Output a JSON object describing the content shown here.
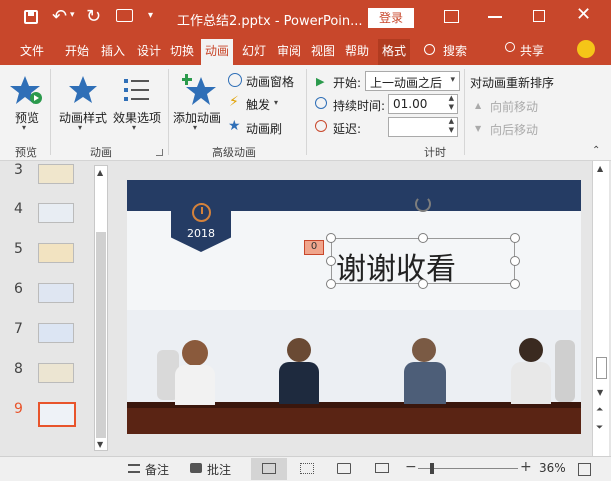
{
  "window": {
    "title": "工作总结2.pptx  -  PowerPoin...",
    "login_label": "登录"
  },
  "tabs": [
    {
      "label": "文件"
    },
    {
      "label": "开始"
    },
    {
      "label": "插入"
    },
    {
      "label": "设计"
    },
    {
      "label": "切换"
    },
    {
      "label": "动画"
    },
    {
      "label": "幻灯"
    },
    {
      "label": "审阅"
    },
    {
      "label": "视图"
    },
    {
      "label": "帮助"
    },
    {
      "label": "格式"
    }
  ],
  "search_label": "搜索",
  "share_label": "共享",
  "ribbon": {
    "preview_label": "预览",
    "anim_style_label": "动画样式",
    "effect_options_label": "效果选项",
    "add_anim_label": "添加动画",
    "anim_pane_label": "动画窗格",
    "trigger_label": "触发",
    "anim_painter_label": "动画刷",
    "start_label": "开始:",
    "start_value": "上一动画之后",
    "duration_label": "持续时间:",
    "duration_value": "01.00",
    "delay_label": "延迟:",
    "delay_value": "",
    "reorder_label": "对动画重新排序",
    "move_earlier_label": "向前移动",
    "move_later_label": "向后移动",
    "groups": {
      "preview": "预览",
      "animation": "动画",
      "advanced": "高级动画",
      "timing": "计时"
    }
  },
  "slides": [
    {
      "num": "3"
    },
    {
      "num": "4"
    },
    {
      "num": "5"
    },
    {
      "num": "6"
    },
    {
      "num": "7"
    },
    {
      "num": "8"
    },
    {
      "num": "9"
    }
  ],
  "slide": {
    "year": "2018",
    "anim_tag": "0",
    "title": "谢谢收看"
  },
  "status": {
    "notes_label": "备注",
    "comments_label": "批注",
    "zoom": "36%"
  },
  "colors": {
    "accent": "#c8472b",
    "banner": "#253c64",
    "selected_slide": "#e8542b"
  }
}
